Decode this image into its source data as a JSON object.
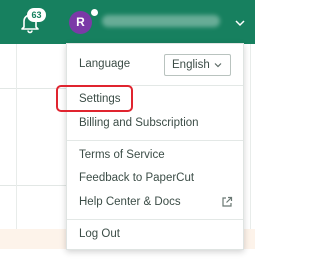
{
  "header": {
    "notifications_count": "63",
    "avatar_initial": "R"
  },
  "menu": {
    "language_label": "Language",
    "language_value": "English",
    "settings_label": "Settings",
    "billing_label": "Billing and Subscription",
    "terms_label": "Terms of Service",
    "feedback_label": "Feedback to PaperCut",
    "help_label": "Help Center & Docs",
    "logout_label": "Log Out"
  },
  "colors": {
    "header_bg": "#17805f",
    "avatar_bg": "#7b3aa7",
    "highlight": "#e0242f"
  },
  "icons": [
    "bell-icon",
    "chevron-down-icon",
    "external-link-icon"
  ]
}
